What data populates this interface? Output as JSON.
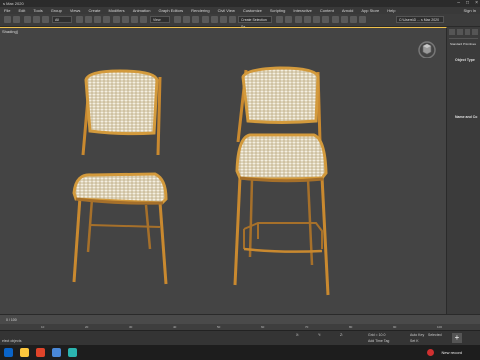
{
  "window": {
    "title": "s Max 2020"
  },
  "signin": "Sign In",
  "menubar": [
    "File",
    "Edit",
    "Tools",
    "Group",
    "Views",
    "Create",
    "Modifiers",
    "Animation",
    "Graph Editors",
    "Rendering",
    "Civil View",
    "Customize",
    "Scripting",
    "Interactive",
    "Content",
    "Arnold",
    "App Store",
    "Help"
  ],
  "toolbar": {
    "filter_label": "All",
    "view_label": "View",
    "selection_set": "Create Selection Se",
    "workspace": "C:\\Users\\D ... s Max 2020"
  },
  "viewport": {
    "label": "Shading]"
  },
  "command_panel": {
    "dropdown": "Standard Primitives",
    "section_object_type": "Object Type",
    "section_name_color": "Name and Co"
  },
  "timeline": {
    "frame_label": "0 / 100"
  },
  "ruler_ticks": [
    "10",
    "20",
    "30",
    "40",
    "50",
    "60",
    "70",
    "80",
    "90",
    "100"
  ],
  "status": {
    "selected": "elect objects",
    "x_label": "X:",
    "y_label": "Y:",
    "z_label": "Z:",
    "grid": "Grid = 10.0",
    "add_time_tag": "Add Time Tag",
    "auto_key": "Auto Key",
    "set_key": "Set K",
    "selected_dd": "Selected",
    "frame_field": "0"
  },
  "taskbar": {
    "tray": "New record"
  },
  "colors": {
    "wood": "#d39a3c",
    "wood_dark": "#a6702a",
    "cane": "#e9e2cf",
    "viewport_bg": "#444444"
  }
}
